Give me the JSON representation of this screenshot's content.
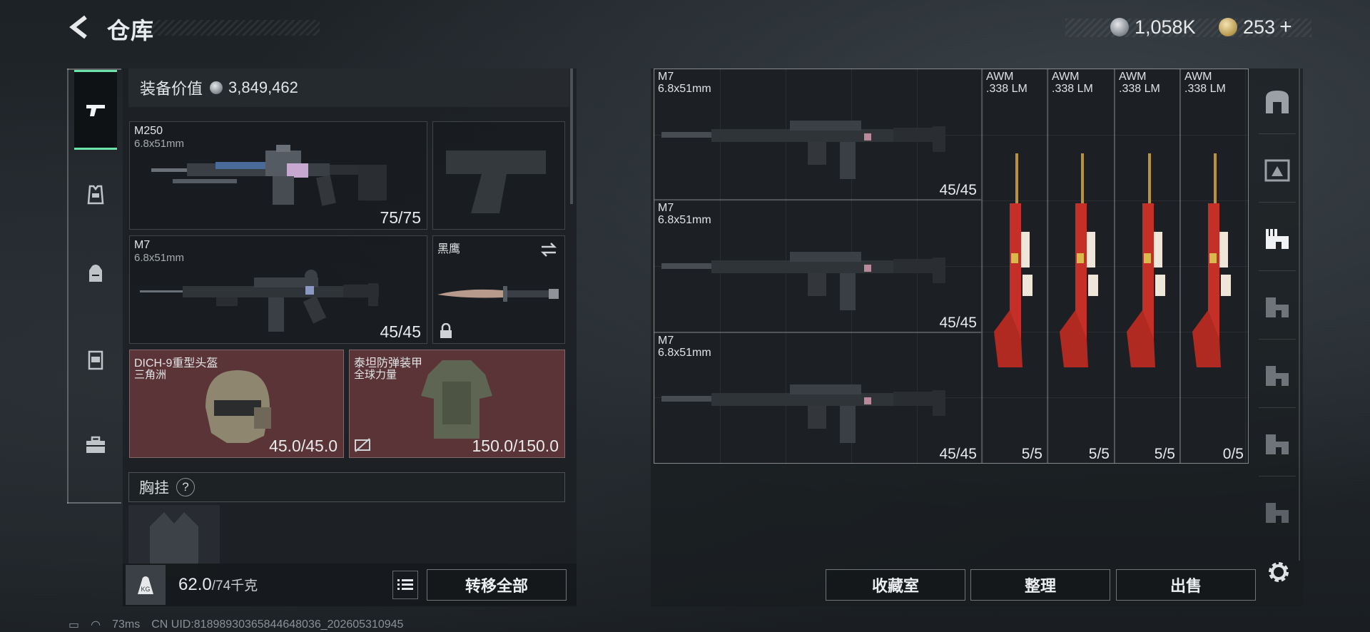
{
  "header": {
    "title": "仓库",
    "silver": "1,058K",
    "gold": "253",
    "add": "+"
  },
  "loadout": {
    "value_label": "装备价值",
    "value": "3,849,462",
    "primary": {
      "name": "M250",
      "caliber": "6.8x51mm",
      "ammo": "75/75"
    },
    "secondary": {
      "name": "M7",
      "caliber": "6.8x51mm",
      "ammo": "45/45"
    },
    "melee": {
      "name": "黑鹰"
    },
    "helmet": {
      "name": "DICH-9重型头盔",
      "brand": "三角洲",
      "durability": "45.0/45.0"
    },
    "armor": {
      "name": "泰坦防弹装甲",
      "brand": "全球力量",
      "durability": "150.0/150.0"
    },
    "chest_rig_label": "胸挂",
    "help": "?"
  },
  "footer": {
    "weight": "62.0",
    "capacity": "/74千克",
    "transfer_all": "转移全部"
  },
  "storage": {
    "collection": "收藏室",
    "sort": "整理",
    "sell": "出售",
    "items": [
      {
        "name": "M7",
        "caliber": "6.8x51mm",
        "count": "45/45",
        "kind": "rifle"
      },
      {
        "name": "M7",
        "caliber": "6.8x51mm",
        "count": "45/45",
        "kind": "rifle"
      },
      {
        "name": "M7",
        "caliber": "6.8x51mm",
        "count": "45/45",
        "kind": "rifle"
      },
      {
        "name": "AWM",
        "caliber": ".338 LM",
        "count": "5/5",
        "kind": "sniper"
      },
      {
        "name": "AWM",
        "caliber": ".338 LM",
        "count": "5/5",
        "kind": "sniper"
      },
      {
        "name": "AWM",
        "caliber": ".338 LM",
        "count": "5/5",
        "kind": "sniper"
      },
      {
        "name": "AWM",
        "caliber": ".338 LM",
        "count": "0/5",
        "kind": "sniper"
      }
    ]
  },
  "status": {
    "ping": "73ms",
    "uid": "CN UID:8189893036584464803б_202605310945"
  }
}
